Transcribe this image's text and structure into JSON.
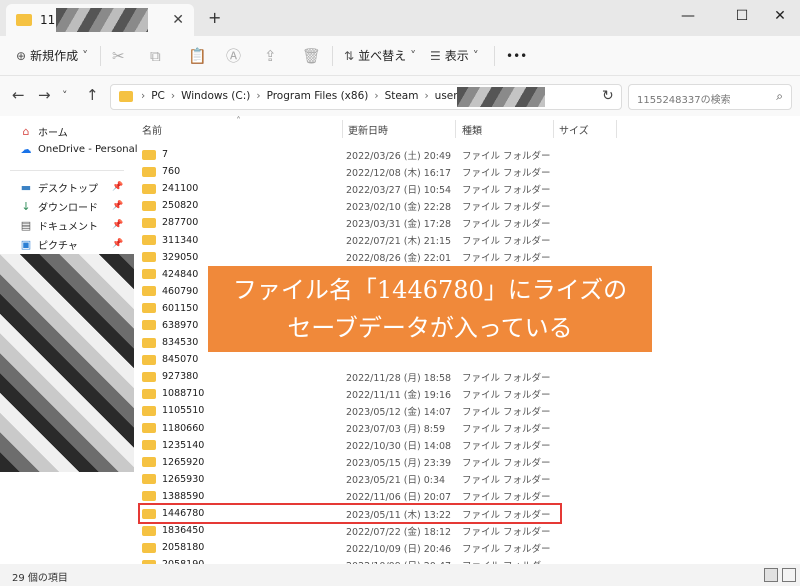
{
  "window": {
    "tab_title": "115",
    "new_tab_label": "+",
    "minimize_label": "—",
    "maximize_label": "☐",
    "close_label": "✕"
  },
  "toolbar": {
    "new_label": "新規作成",
    "sort_label": "並べ替え",
    "view_label": "表示",
    "more_label": "•••"
  },
  "address": {
    "breadcrumbs": [
      "PC",
      "Windows (C:)",
      "Program Files (x86)",
      "Steam",
      "userdata",
      "115"
    ],
    "search_placeholder": "1155248337の検索"
  },
  "sidebar": {
    "items": [
      {
        "label": "ホーム",
        "icon": "home-icon"
      },
      {
        "label": "OneDrive - Personal",
        "icon": "cloud-icon"
      },
      {
        "label": "デスクトップ",
        "icon": "desktop-icon",
        "pinned": true
      },
      {
        "label": "ダウンロード",
        "icon": "download-icon",
        "pinned": true
      },
      {
        "label": "ドキュメント",
        "icon": "document-icon",
        "pinned": true
      },
      {
        "label": "ピクチャ",
        "icon": "picture-icon",
        "pinned": true
      }
    ]
  },
  "columns": {
    "name": "名前",
    "date": "更新日時",
    "type": "種類",
    "size": "サイズ"
  },
  "files": [
    {
      "name": "7",
      "date": "2022/03/26 (土) 20:49",
      "type": "ファイル フォルダー"
    },
    {
      "name": "760",
      "date": "2022/12/08 (木) 16:17",
      "type": "ファイル フォルダー"
    },
    {
      "name": "241100",
      "date": "2022/03/27 (日) 10:54",
      "type": "ファイル フォルダー"
    },
    {
      "name": "250820",
      "date": "2023/02/10 (金) 22:28",
      "type": "ファイル フォルダー"
    },
    {
      "name": "287700",
      "date": "2023/03/31 (金) 17:28",
      "type": "ファイル フォルダー"
    },
    {
      "name": "311340",
      "date": "2022/07/21 (木) 21:15",
      "type": "ファイル フォルダー"
    },
    {
      "name": "329050",
      "date": "2022/08/26 (金) 22:01",
      "type": "ファイル フォルダー"
    },
    {
      "name": "424840",
      "date": "",
      "type": "ファイル フォルダー"
    },
    {
      "name": "460790",
      "date": "",
      "type": ""
    },
    {
      "name": "601150",
      "date": "",
      "type": ""
    },
    {
      "name": "638970",
      "date": "",
      "type": ""
    },
    {
      "name": "834530",
      "date": "",
      "type": ""
    },
    {
      "name": "845070",
      "date": "",
      "type": ""
    },
    {
      "name": "927380",
      "date": "2022/11/28 (月) 18:58",
      "type": "ファイル フォルダー"
    },
    {
      "name": "1088710",
      "date": "2022/11/11 (金) 19:16",
      "type": "ファイル フォルダー"
    },
    {
      "name": "1105510",
      "date": "2023/05/12 (金) 14:07",
      "type": "ファイル フォルダー"
    },
    {
      "name": "1180660",
      "date": "2023/07/03 (月) 8:59",
      "type": "ファイル フォルダー"
    },
    {
      "name": "1235140",
      "date": "2022/10/30 (日) 14:08",
      "type": "ファイル フォルダー"
    },
    {
      "name": "1265920",
      "date": "2023/05/15 (月) 23:39",
      "type": "ファイル フォルダー"
    },
    {
      "name": "1265930",
      "date": "2023/05/21 (日) 0:34",
      "type": "ファイル フォルダー"
    },
    {
      "name": "1388590",
      "date": "2022/11/06 (日) 20:07",
      "type": "ファイル フォルダー"
    },
    {
      "name": "1446780",
      "date": "2023/05/11 (木) 13:22",
      "type": "ファイル フォルダー",
      "highlighted": true
    },
    {
      "name": "1836450",
      "date": "2022/07/22 (金) 18:12",
      "type": "ファイル フォルダー"
    },
    {
      "name": "2058180",
      "date": "2022/10/09 (日) 20:46",
      "type": "ファイル フォルダー"
    },
    {
      "name": "2058190",
      "date": "2022/10/09 (日) 20:47",
      "type": "ファイル フォルダー"
    }
  ],
  "callout": {
    "line1": "ファイル名「1446780」にライズの",
    "line2": "セーブデータが入っている"
  },
  "status": {
    "item_count": "29 個の項目"
  },
  "colors": {
    "folder": "#f5c242",
    "callout": "#f0893a",
    "highlight": "#e53935"
  }
}
